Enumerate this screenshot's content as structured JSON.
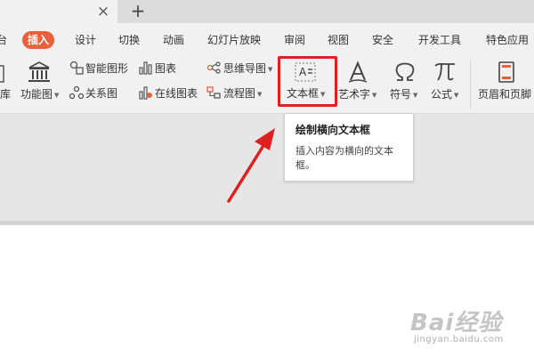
{
  "tabbar": {
    "close_glyph": "×",
    "new_tab_glyph": "+"
  },
  "menu": {
    "items": [
      "台",
      "插入",
      "设计",
      "切换",
      "动画",
      "幻灯片放映",
      "审阅",
      "视图",
      "安全",
      "开发工具",
      "特色应用"
    ],
    "active_index": 1,
    "active_color": "#e8603c"
  },
  "ribbon": {
    "lib": "库",
    "function_chart": "功能图",
    "smart_shape": "智能图形",
    "chart": "图表",
    "mind_map": "思维导图",
    "relation_chart": "关系图",
    "online_chart": "在线图表",
    "flowchart": "流程图",
    "textbox": "文本框",
    "textbox_icon_text": "A",
    "wordart": "艺术字",
    "symbol": "符号",
    "formula": "公式",
    "header_footer": "页眉和页脚"
  },
  "icons": {
    "function_chart": "building-columns-icon",
    "smart_shape": "smart-shape-icon",
    "chart": "bar-chart-icon",
    "mind_map": "mind-map-icon",
    "relation_chart": "relation-icon",
    "online_chart": "online-chart-icon",
    "flowchart": "flowchart-icon",
    "textbox": "textbox-icon",
    "wordart": "wordart-icon",
    "symbol": "omega-icon",
    "formula": "pi-icon",
    "header_footer": "page-icon"
  },
  "tooltip": {
    "title": "绘制横向文本框",
    "description": "插入内容为横向的文本框。"
  },
  "annotation": {
    "highlight_color": "#e02020",
    "arrow_color": "#e02020"
  },
  "watermark": {
    "brand": "Bai经验",
    "url": "jingyan.baidu.com"
  }
}
